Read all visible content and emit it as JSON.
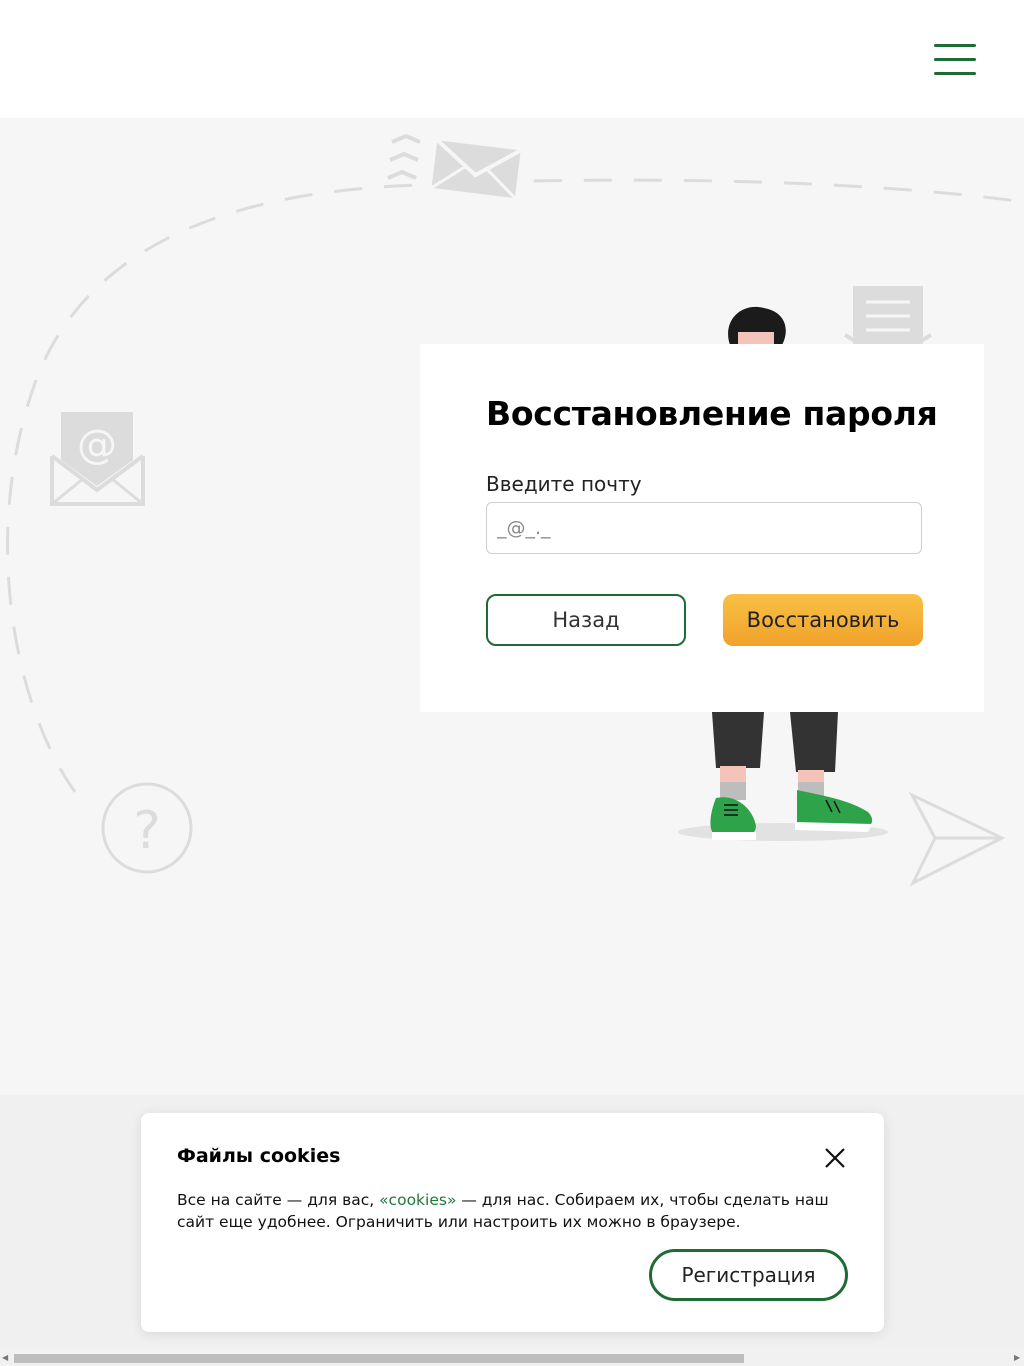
{
  "header": {
    "menu_icon": "hamburger-menu-icon",
    "accent_color": "#1e6b34"
  },
  "recovery": {
    "title": "Восстановление пароля",
    "email_label": "Введите почту",
    "email_placeholder": "_@_._",
    "back_label": "Назад",
    "restore_label": "Восстановить"
  },
  "cookies": {
    "title": "Файлы cookies",
    "text_before": "Все на сайте — для вас, ",
    "link_text": "«cookies»",
    "text_after": " — для нас. Собираем их, чтобы сделать наш сайт еще удобнее. Ограничить или настроить их можно в браузере.",
    "register_label": "Регистрация",
    "close_icon": "close-icon"
  },
  "background": {
    "icons": [
      "envelope-icon",
      "at-envelope-icon",
      "document-envelope-icon",
      "question-icon",
      "paper-plane-icon",
      "person-illustration"
    ],
    "question_glyph": "?",
    "at_glyph": "@"
  },
  "colors": {
    "primary_green": "#1e6b34",
    "button_orange": "#f1a22b",
    "shoe_green": "#2fa34a"
  }
}
